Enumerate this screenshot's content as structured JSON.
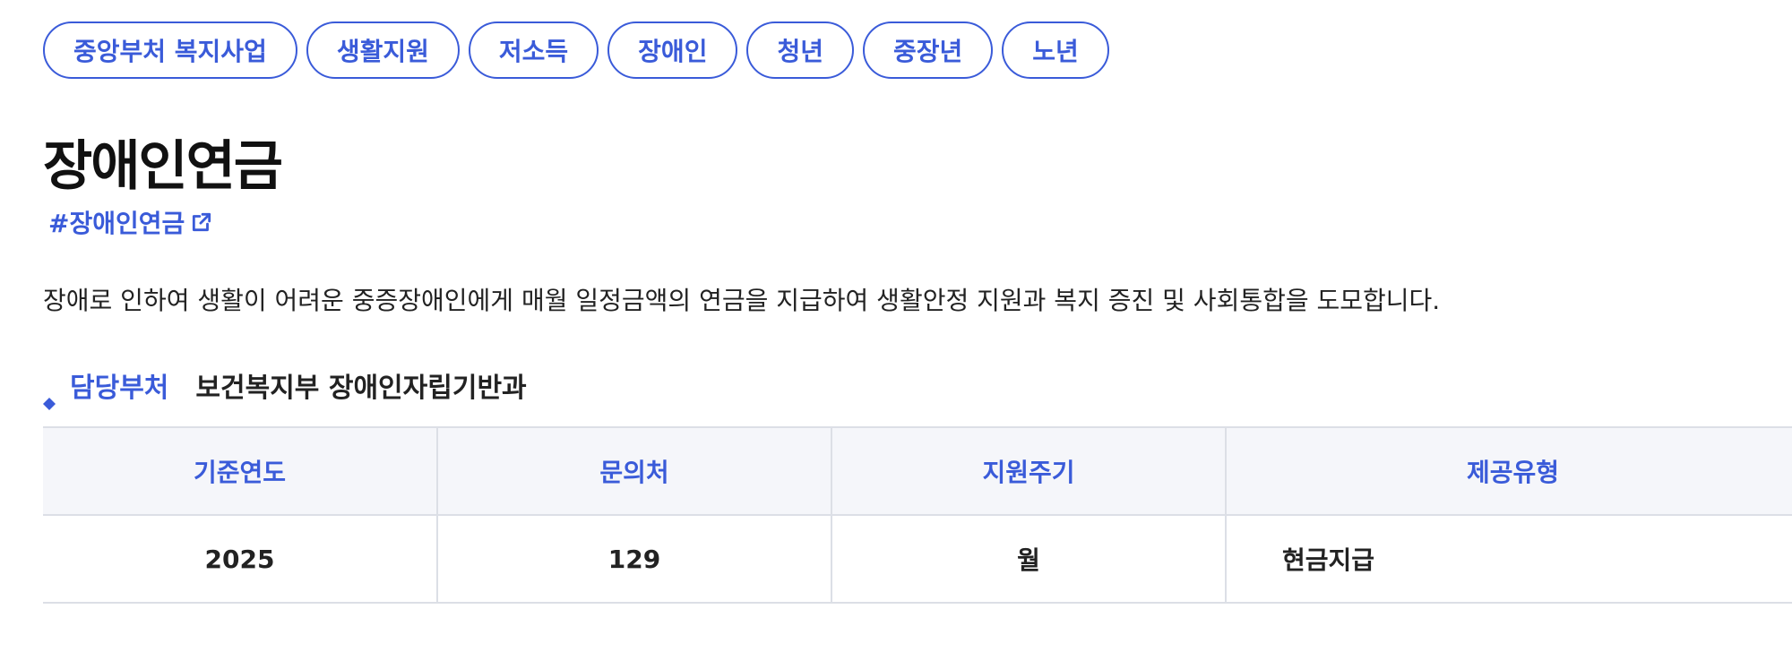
{
  "tags": [
    "중앙부처 복지사업",
    "생활지원",
    "저소득",
    "장애인",
    "청년",
    "중장년",
    "노년"
  ],
  "title": "장애인연금",
  "hashtag": "#장애인연금",
  "description": "장애로 인하여 생활이 어려운 중증장애인에게 매월 일정금액의 연금을 지급하여 생활안정 지원과 복지 증진 및 사회통합을 도모합니다.",
  "department": {
    "label": "담당부처",
    "value": "보건복지부 장애인자립기반과"
  },
  "table": {
    "headers": [
      "기준연도",
      "문의처",
      "지원주기",
      "제공유형"
    ],
    "row": [
      "2025",
      "129",
      "월",
      "현금지급"
    ]
  },
  "colors": {
    "accent": "#3a5bd9",
    "header_bg": "#f5f6fa",
    "border": "#dcdfe6"
  },
  "icons": {
    "hashtag_link": "external-link-icon",
    "department_bullet": "diamond-bullet-icon"
  }
}
